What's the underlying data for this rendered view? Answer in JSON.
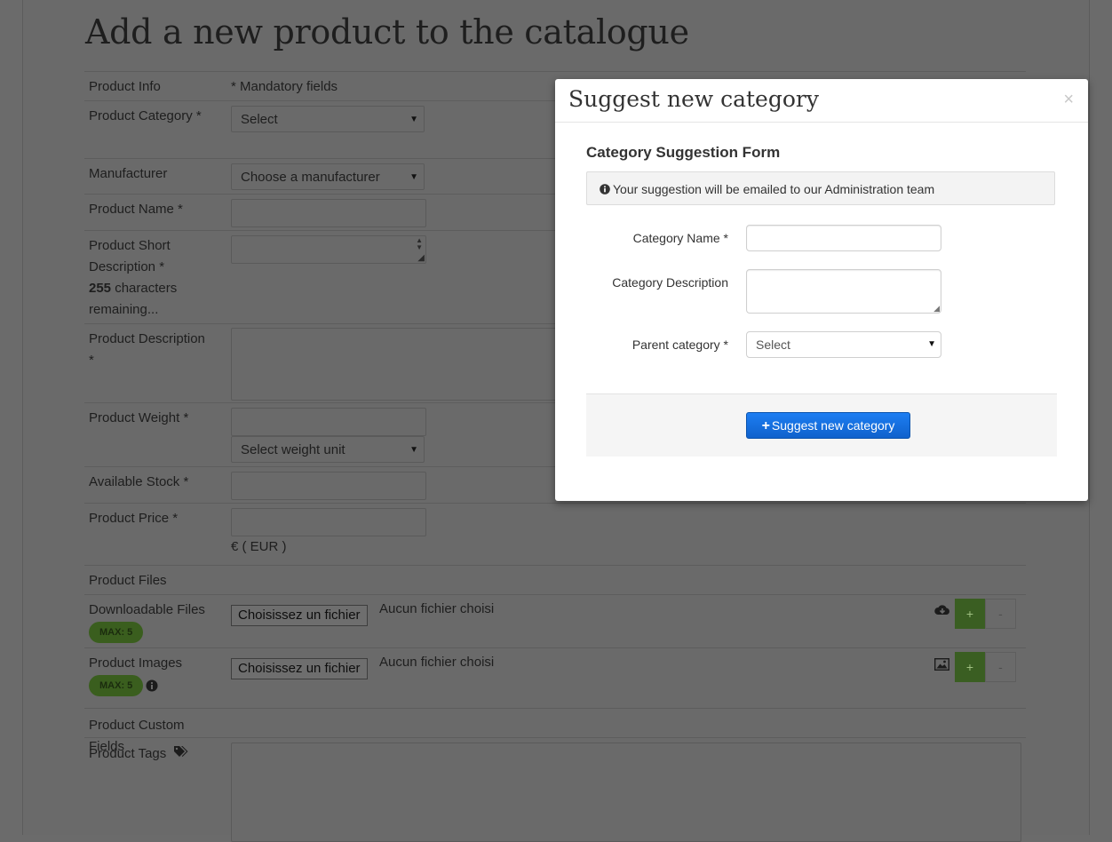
{
  "page": {
    "title": "Add a new product to the catalogue"
  },
  "form": {
    "product_info_label": "Product Info",
    "mandatory_note": "* Mandatory fields",
    "category_label": "Product Category *",
    "category_value": "Select",
    "manufacturer_label": "Manufacturer",
    "manufacturer_value": "Choose a manufacturer",
    "name_label": "Product Name *",
    "short_desc_label_line1": "Product Short",
    "short_desc_label_line2": "Description *",
    "short_desc_count": "255",
    "short_desc_count_suffix": " characters",
    "short_desc_remaining": "remaining...",
    "description_label_line1": "Product Description",
    "description_label_line2": "*",
    "weight_label": "Product Weight *",
    "weight_unit_value": "Select weight unit",
    "stock_label": "Available Stock *",
    "price_label": "Product Price *",
    "price_currency": "€ ( EUR )",
    "files_section_label": "Product Files",
    "downloadable_label": "Downloadable Files",
    "downloadable_badge": "MAX: 5",
    "downloadable_button": "Choisissez un fichier",
    "downloadable_status": "Aucun fichier choisi",
    "images_label": "Product Images",
    "images_badge": "MAX: 5",
    "images_button": "Choisissez un fichier",
    "images_status": "Aucun fichier choisi",
    "add_label": "+",
    "remove_label": "-",
    "custom_fields_label": "Product Custom Fields",
    "tags_label": "Product Tags"
  },
  "modal": {
    "title": "Suggest new category",
    "close_label": "×",
    "form_title": "Category Suggestion Form",
    "info_text": "Your suggestion will be emailed to our Administration team",
    "name_label": "Category Name *",
    "description_label": "Category Description",
    "parent_label": "Parent category *",
    "parent_value": "Select",
    "submit_label": "Suggest new category"
  },
  "colors": {
    "submit_button": "#1273e6",
    "badge": "#3a5e1e"
  }
}
